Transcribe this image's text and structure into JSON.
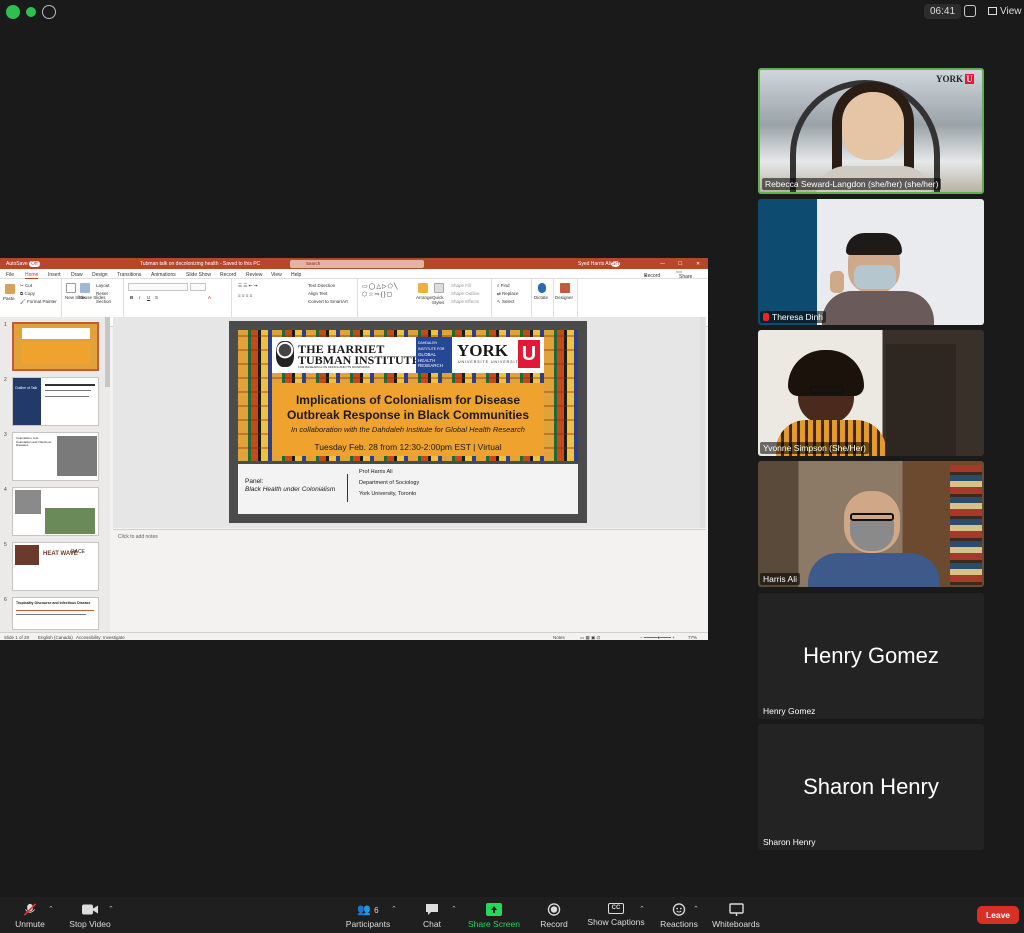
{
  "topbar": {
    "time": "06:41",
    "view_label": "View"
  },
  "ppt": {
    "autosave": "AutoSave",
    "autosave_state": "Off",
    "doc_title": "Tubman talk on decolonizing health - Saved to this PC",
    "search_placeholder": "Search",
    "user": "Syed Harris Ali",
    "user_initials": "SH",
    "menu": [
      "File",
      "Home",
      "Insert",
      "Draw",
      "Design",
      "Transitions",
      "Animations",
      "Slide Show",
      "Record",
      "Review",
      "View",
      "Help"
    ],
    "menu_active": "Home",
    "record_label": "Record",
    "share_label": "Share",
    "ribbon": {
      "clipboard": {
        "paste": "Paste",
        "cut": "Cut",
        "copy": "Copy",
        "format_painter": "Format Painter",
        "label": "Clipboard"
      },
      "slides": {
        "new_slide": "New Slide",
        "reuse": "Reuse Slides",
        "layout": "Layout",
        "reset": "Reset",
        "section": "Section",
        "label": "Slides"
      },
      "font": {
        "label": "Font"
      },
      "paragraph": {
        "text_direction": "Text Direction",
        "align_text": "Align Text",
        "convert": "Convert to SmartArt",
        "label": "Paragraph"
      },
      "drawing": {
        "arrange": "Arrange",
        "quick_styles": "Quick Styles",
        "shape_fill": "Shape Fill",
        "shape_outline": "Shape Outline",
        "shape_effects": "Shape Effects",
        "label": "Drawing"
      },
      "editing": {
        "find": "Find",
        "replace": "Replace",
        "select": "Select",
        "label": "Editing"
      },
      "voice": {
        "dictate": "Dictate",
        "label": "Voice"
      },
      "designer": {
        "designer": "Designer",
        "label": "Designer"
      }
    },
    "thumbnails": [
      {
        "num": "1"
      },
      {
        "num": "2",
        "title": "Outline of Talk"
      },
      {
        "num": "3",
        "title": "Colonialism, Anti-Colonialism and Infectious Diseases"
      },
      {
        "num": "4"
      },
      {
        "num": "5",
        "title": "HEAT WAVE",
        "title2": "RACE"
      },
      {
        "num": "6",
        "title": "Tropicality Discourse and Infectious Disease"
      }
    ],
    "slide": {
      "tubman_line1": "THE HARRIET",
      "tubman_line2": "TUBMAN INSTITUTE",
      "tubman_sub": "FOR RESEARCH ON AFRICA AND ITS DIASPORAS",
      "dahdaleh": [
        "DAHDALEH",
        "INSTITUTE FOR",
        "GLOBAL",
        "HEALTH",
        "RESEARCH"
      ],
      "york": "YORK",
      "york_u": "U",
      "york_sub": "UNIVERSITÉ UNIVERSITY",
      "title_line1": "Implications of Colonialism for Disease",
      "title_line2": "Outbreak Response in Black Communities",
      "collab": "In collaboration with the Dahdaleh Institute for Global Health Research",
      "date": "Tuesday Feb. 28 from 12:30-2:00pm EST | Virtual",
      "panel_label": "Panel:",
      "panel_title": "Black Health under Colonialism",
      "prof_name": "Prof Harris Ali",
      "prof_dept": "Department of Sociology",
      "prof_uni": "York University, Toronto"
    },
    "notes_placeholder": "Click to add notes",
    "status": {
      "slide_of": "Slide 1 of 28",
      "language": "English (Canada)",
      "accessibility": "Accessibility: Investigate",
      "notes": "Notes",
      "zoom": "77%"
    }
  },
  "participants_tiles": [
    {
      "name": "Rebecca Seward-Langdon (she/her) (she/her)",
      "active": true,
      "video": true,
      "brand": "YORK"
    },
    {
      "name": "Theresa Dinh",
      "video": true,
      "muted": true
    },
    {
      "name": "Yvonne Simpson (She/Her)",
      "video": true
    },
    {
      "name": "Harris Ali",
      "video": true
    },
    {
      "name": "Henry Gomez",
      "video": false,
      "big_name": "Henry Gomez"
    },
    {
      "name": "Sharon Henry",
      "video": false,
      "big_name": "Sharon Henry"
    }
  ],
  "toolbar": {
    "unmute": "Unmute",
    "stop_video": "Stop Video",
    "participants": "Participants",
    "participants_count": "6",
    "chat": "Chat",
    "share_screen": "Share Screen",
    "record": "Record",
    "show_captions": "Show Captions",
    "captions_icon_text": "CC",
    "reactions": "Reactions",
    "whiteboards": "Whiteboards",
    "leave": "Leave"
  },
  "colors": {
    "ppt_accent": "#b7472a",
    "active_speaker": "#5fb04f",
    "share_green": "#23d959",
    "leave_red": "#d93025"
  }
}
